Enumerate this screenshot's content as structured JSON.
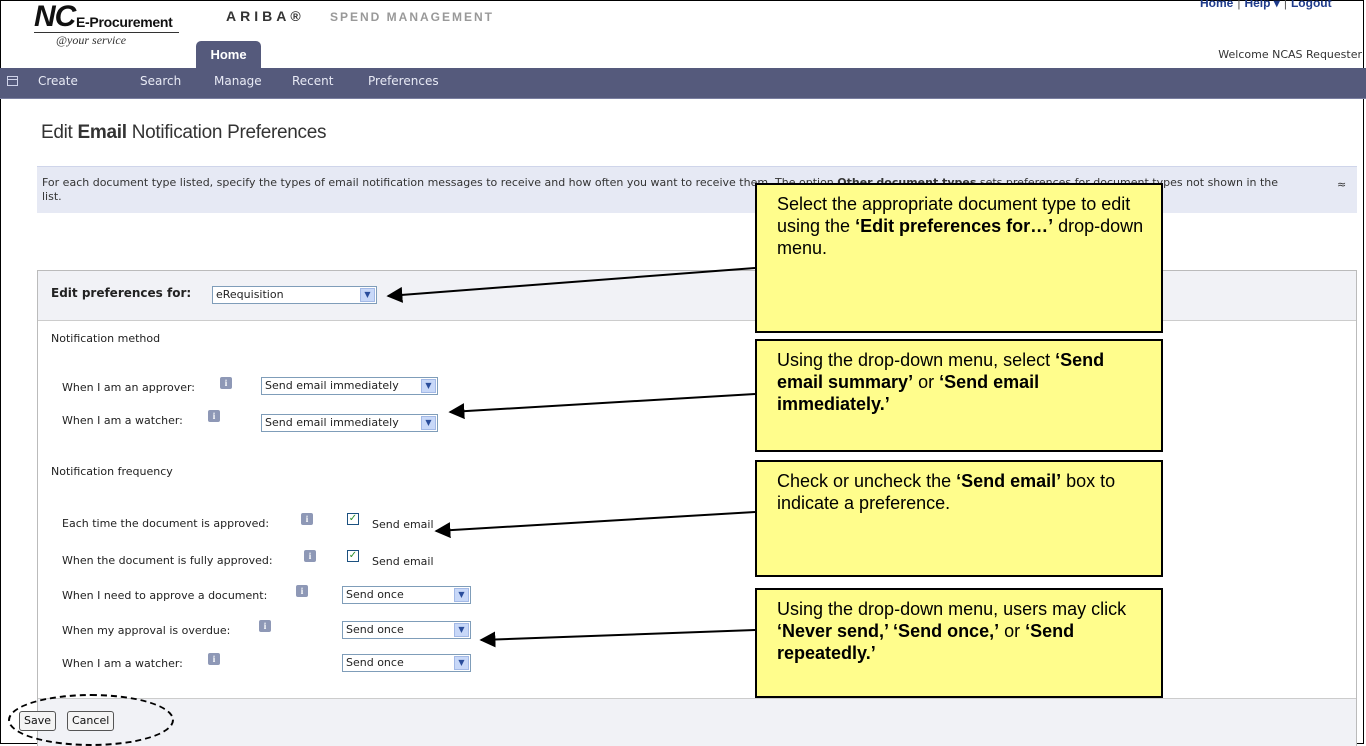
{
  "header": {
    "logo_main": "NC",
    "logo_sub": "E-Procurement",
    "logo_tagline": "@your service",
    "ariba": "ARIBA®",
    "spend_management": "SPEND MANAGEMENT",
    "home_tab": "Home",
    "links": [
      "Home",
      "Help ▾",
      "Logout"
    ],
    "welcome": "Welcome NCAS Requester"
  },
  "nav": {
    "items": [
      "Create",
      "Search",
      "Manage",
      "Recent",
      "Preferences"
    ]
  },
  "page": {
    "title_part1": "Edit ",
    "title_bold": "Email",
    "title_part2": " Notification Preferences",
    "info_text_1": "For each document type listed, specify the types of email notification messages to receive and how often you want to receive them. The option ",
    "info_text_bold": "Other document types",
    "info_text_2": " sets preferences for document types not shown in the list.",
    "collapse_symbol": "≈"
  },
  "form": {
    "edit_label": "Edit preferences for:",
    "edit_value": "eRequisition",
    "method_heading": "Notification method",
    "approver_label": "When I am an approver:",
    "approver_value": "Send email immediately",
    "watcher_label": "When I am a watcher:",
    "watcher_value": "Send email immediately",
    "frequency_heading": "Notification frequency",
    "approved_label": "Each time the document is approved:",
    "approved_checkbox": "Send email",
    "approved_checked": true,
    "fully_label": "When the document is fully approved:",
    "fully_checkbox": "Send email",
    "fully_checked": true,
    "need_label": "When I need to approve a document:",
    "need_value": "Send once",
    "overdue_label": "When my approval is overdue:",
    "overdue_value": "Send once",
    "watcher2_label": "When I am a watcher:",
    "watcher2_value": "Send once",
    "info_glyph": "i",
    "check_glyph": "✓"
  },
  "buttons": {
    "save": "Save",
    "cancel": "Cancel"
  },
  "callouts": {
    "c1_a": "Select the appropriate document type to edit using the ",
    "c1_b": "‘Edit preferences for…’",
    "c1_c": " drop-down menu.",
    "c2_a": "Using the drop-down menu, select ",
    "c2_b": "‘Send email summary’",
    "c2_c": " or ",
    "c2_d": "‘Send email immediately.’",
    "c3_a": "Check or uncheck the ",
    "c3_b": "‘Send email’",
    "c3_c": " box to indicate a preference.",
    "c4_a": "Using the drop-down menu, users may click ",
    "c4_b": "‘Never send,’ ‘Send once,’",
    "c4_c": " or ",
    "c4_d": "‘Send repeatedly.’"
  },
  "colors": {
    "nav_bar": "#555a7c",
    "callout_bg": "#fffd8c",
    "info_bg": "#e6e9f4",
    "link": "#1e3a8a"
  }
}
